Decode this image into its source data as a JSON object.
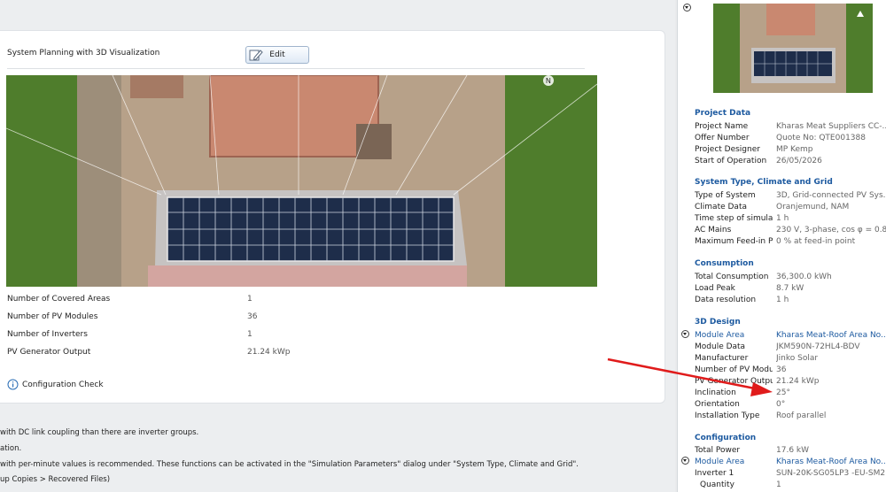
{
  "card": {
    "title": "System Planning with 3D Visualization",
    "edit_label": "Edit",
    "north_label": "N",
    "stats": [
      {
        "label": "Number of Covered Areas",
        "value": "1"
      },
      {
        "label": "Number of PV Modules",
        "value": "36"
      },
      {
        "label": "Number of Inverters",
        "value": "1"
      },
      {
        "label": "PV Generator Output",
        "value": "21.24 kWp"
      }
    ],
    "config_check": "Configuration Check"
  },
  "messages": [
    "with DC link coupling than there are inverter groups.",
    "ation.",
    "with per-minute values is recommended. These functions can be activated in the \"Simulation Parameters\" dialog under \"System Type, Climate and Grid\".",
    "up Copies > Recovered Files)"
  ],
  "sidebar": {
    "project": {
      "title": "Project Data",
      "rows": [
        {
          "k": "Project Name",
          "v": "Kharas Meat Suppliers CC-..."
        },
        {
          "k": "Offer Number",
          "v": "Quote No: QTE001388"
        },
        {
          "k": "Project Designer",
          "v": "MP Kemp"
        },
        {
          "k": "Start of Operation",
          "v": "26/05/2026"
        }
      ]
    },
    "system": {
      "title": "System Type, Climate and Grid",
      "rows": [
        {
          "k": "Type of System",
          "v": "3D, Grid-connected PV Sys..."
        },
        {
          "k": "Climate Data",
          "v": "Oranjemund, NAM"
        },
        {
          "k": "Time step of simula...",
          "v": "1 h"
        },
        {
          "k": "AC Mains",
          "v": "230 V, 3-phase, cos φ = 0.8"
        },
        {
          "k": "Maximum Feed-in P...",
          "v": "0 % at feed-in point"
        }
      ]
    },
    "consumption": {
      "title": "Consumption",
      "rows": [
        {
          "k": "Total Consumption",
          "v": "36,300.0 kWh"
        },
        {
          "k": "Load Peak",
          "v": "8.7 kW"
        },
        {
          "k": "Data resolution",
          "v": "1 h"
        }
      ]
    },
    "design": {
      "title": "3D Design",
      "module_area_label": "Module Area",
      "module_area_value": "Kharas Meat-Roof Area No...",
      "rows": [
        {
          "k": "Module Data",
          "v": "JKM590N-72HL4-BDV"
        },
        {
          "k": "Manufacturer",
          "v": "Jinko Solar"
        },
        {
          "k": "Number of PV Modu...",
          "v": "36"
        },
        {
          "k": "PV Generator Output",
          "v": "21.24 kWp"
        },
        {
          "k": "Inclination",
          "v": "25°"
        },
        {
          "k": "Orientation",
          "v": "0°"
        },
        {
          "k": "Installation Type",
          "v": "Roof parallel"
        }
      ]
    },
    "configuration": {
      "title": "Configuration",
      "total_power_label": "Total Power",
      "total_power_value": "17.6 kW",
      "module_area_label": "Module Area",
      "module_area_value": "Kharas Meat-Roof Area No...",
      "inverter_label": "Inverter 1",
      "inverter_value": "SUN-20K-SG05LP3 -EU-SM2",
      "quantity_label": "Quantity",
      "quantity_value": "1"
    }
  },
  "colors": {
    "accent": "#1d5aa0",
    "annotation_arrow": "#e01b1b",
    "grass": "#4f7d2c",
    "roof": "#c98870",
    "panel": "#1e2d4a"
  }
}
